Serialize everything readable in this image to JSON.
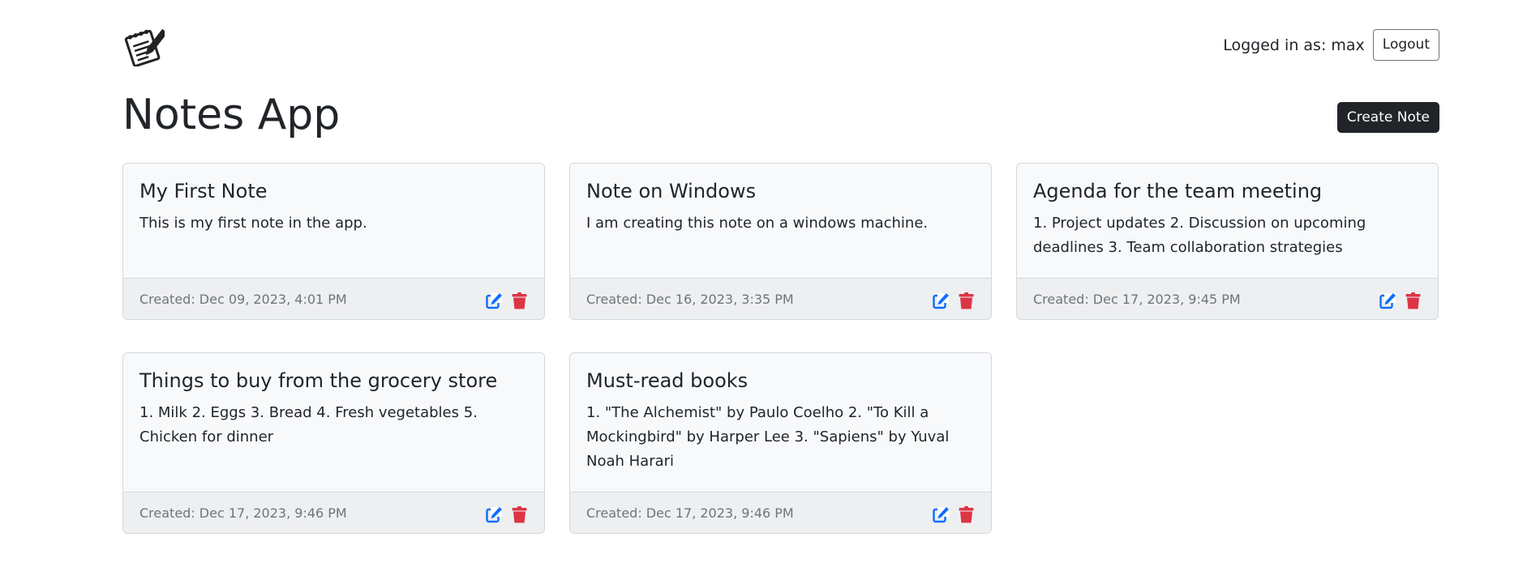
{
  "header": {
    "logged_in_label": "Logged in as: max",
    "logout_label": "Logout"
  },
  "page": {
    "title": "Notes App",
    "create_label": "Create Note"
  },
  "notes": [
    {
      "title": "My First Note",
      "body": "This is my first note in the app.",
      "created": "Created: Dec 09, 2023, 4:01 PM"
    },
    {
      "title": "Note on Windows",
      "body": "I am creating this note on a windows machine.",
      "created": "Created: Dec 16, 2023, 3:35 PM"
    },
    {
      "title": "Agenda for the team meeting",
      "body": "1. Project updates 2. Discussion on upcoming deadlines 3. Team collaboration strategies",
      "created": "Created: Dec 17, 2023, 9:45 PM"
    },
    {
      "title": "Things to buy from the grocery store",
      "body": "1. Milk 2. Eggs 3. Bread 4. Fresh vegetables 5. Chicken for dinner",
      "created": "Created: Dec 17, 2023, 9:46 PM"
    },
    {
      "title": "Must-read books",
      "body": "1. \"The Alchemist\" by Paulo Coelho 2. \"To Kill a Mockingbird\" by Harper Lee 3. \"Sapiens\" by Yuval Noah Harari",
      "created": "Created: Dec 17, 2023, 9:46 PM"
    }
  ],
  "icons": {
    "logo": "notepad-pencil-icon",
    "edit": "edit-icon",
    "delete": "trash-icon"
  },
  "colors": {
    "edit": "#0d6efd",
    "delete": "#dc3545",
    "primary_dark": "#212529"
  }
}
